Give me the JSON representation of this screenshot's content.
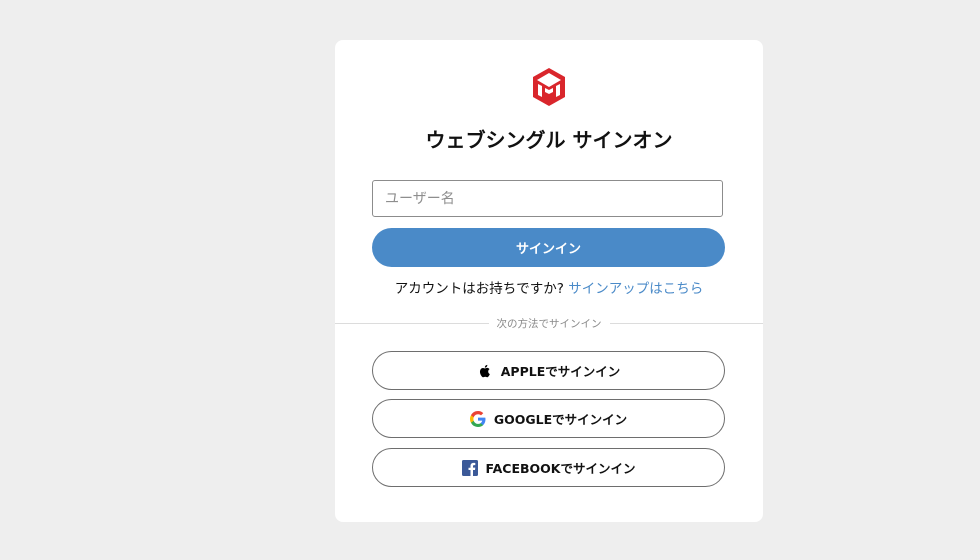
{
  "app": {
    "title": "ウェブシングル サインオン"
  },
  "form": {
    "username_placeholder": "ユーザー名",
    "username_value": "",
    "signin_label": "サインイン"
  },
  "signup": {
    "prompt": "アカウントはお持ちですか?",
    "link_label": "サインアップはこちら"
  },
  "divider": {
    "label": "次の方法でサインイン"
  },
  "social": {
    "apple": {
      "label": "APPLEでサインイン",
      "icon": "apple-icon"
    },
    "google": {
      "label": "GOOGLEでサインイン",
      "icon": "google-icon"
    },
    "facebook": {
      "label": "FACEBOOKでサインイン",
      "icon": "facebook-icon"
    }
  },
  "colors": {
    "brand_red": "#d9262c",
    "accent_blue": "#4a8ac8",
    "facebook_blue": "#3b5998",
    "background": "#eeeeee"
  }
}
